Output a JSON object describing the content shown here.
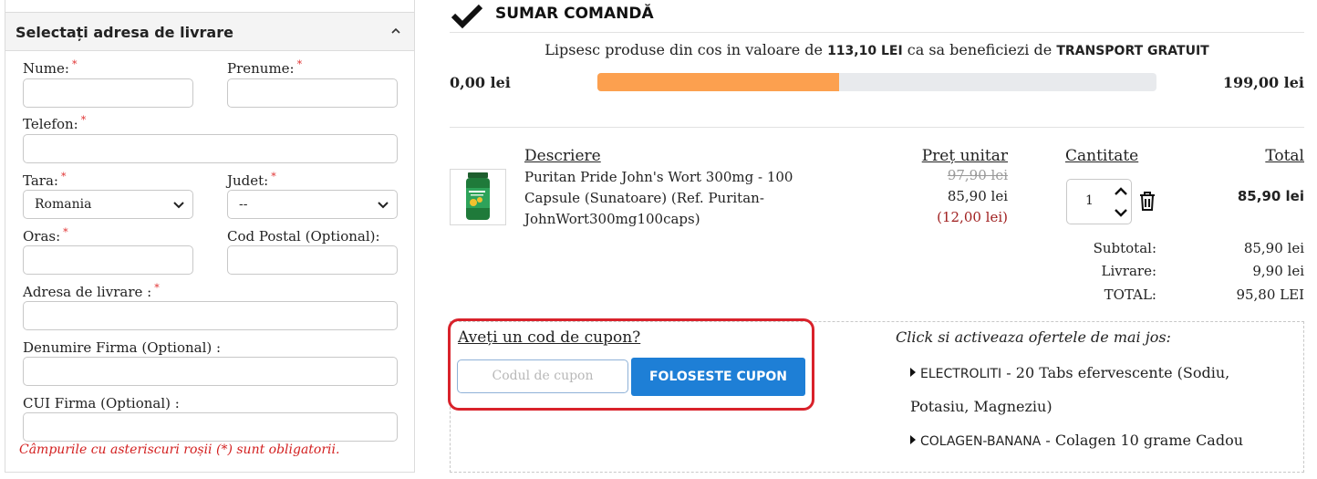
{
  "address": {
    "title": "Selectați adresa de livrare",
    "labels": {
      "nume": "Nume:",
      "prenume": "Prenume:",
      "telefon": "Telefon:",
      "tara": "Tara:",
      "judet": "Judet:",
      "oras": "Oras:",
      "cod_postal": "Cod Postal (Optional):",
      "adresa": "Adresa de livrare :",
      "firma": "Denumire Firma (Optional) :",
      "cui": "CUI Firma (Optional) :"
    },
    "required_mark": "*",
    "tara_value": "Romania",
    "judet_value": "--",
    "required_note": "Câmpurile cu asteriscuri roșii (*) sunt obligatorii."
  },
  "summary": {
    "title": "SUMAR COMANDĂ",
    "shipping": {
      "msg_before": "Lipsesc produse din cos in valoare de",
      "missing_amount": "113,10 LEI",
      "msg_middle": "ca sa beneficiezi de",
      "free_shipping": "TRANSPORT GRATUIT",
      "min": "0,00 lei",
      "max": "199,00 lei",
      "progress_fraction": 0.432
    },
    "columns": {
      "descriere": "Descriere",
      "pret": "Preț unitar",
      "cantitate": "Cantitate",
      "total": "Total"
    },
    "item": {
      "description": "Puritan Pride John's Wort 300mg - 100 Capsule (Sunatoare) (Ref. Puritan-JohnWort300mg100caps)",
      "price_old": "97,90 lei",
      "price": "85,90 lei",
      "saving": "(12,00 lei)",
      "quantity": "1",
      "total": "85,90 lei"
    },
    "totals": [
      {
        "label": "Subtotal:",
        "value": "85,90 lei"
      },
      {
        "label": "Livrare:",
        "value": "9,90 lei"
      },
      {
        "label": "TOTAL:",
        "value": "95,80 LEI"
      }
    ]
  },
  "coupon": {
    "question": "Aveți un cod de cupon?",
    "placeholder": "Codul de cupon",
    "button": "FOLOSESTE CUPON"
  },
  "offers": {
    "title": "Click si activeaza ofertele de mai jos:",
    "items": [
      {
        "code": "ELECTROLITI",
        "text": " - 20 Tabs efervescente (Sodiu,",
        "text2": "Potasiu, Magneziu)"
      },
      {
        "code": "COLAGEN-BANANA",
        "text": " - Colagen 10 grame Cadou"
      }
    ]
  },
  "icons": {
    "check": "checkmark-icon",
    "collapse": "chevron-up-icon",
    "select": "chevron-down-icon",
    "qty_up": "chevron-up-icon",
    "qty_down": "chevron-down-icon",
    "trash": "trash-icon"
  },
  "colors": {
    "progress": "#fca04f",
    "button": "#1e7fd6",
    "highlight": "#d9222b",
    "required": "#d32020"
  }
}
